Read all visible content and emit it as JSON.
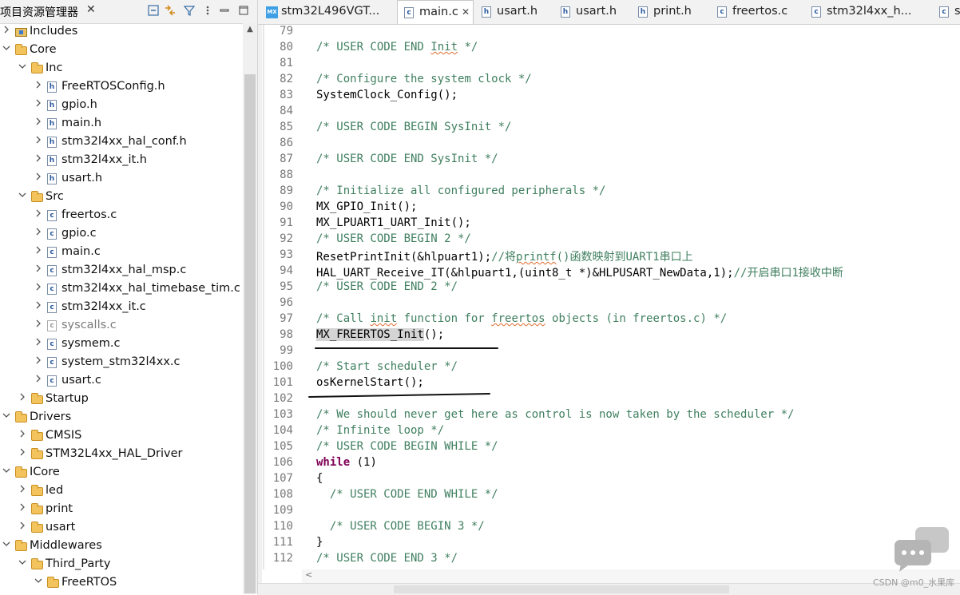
{
  "explorer": {
    "title": "项目资源管理器",
    "close_glyph": "✕",
    "toolbar": [
      "collapse-all-icon",
      "link-editor-icon",
      "filter-icon",
      "view-menu-icon",
      "minimize-icon",
      "maximize-icon"
    ],
    "items": [
      {
        "label": "Includes",
        "icon": "includes",
        "twisty": ">"
      },
      {
        "label": "Core",
        "icon": "folder",
        "twisty": "v"
      },
      {
        "label": "Inc",
        "icon": "folder",
        "twisty": "v"
      },
      {
        "label": "FreeRTOSConfig.h",
        "icon": "h",
        "twisty": ">"
      },
      {
        "label": "gpio.h",
        "icon": "h",
        "twisty": ">"
      },
      {
        "label": "main.h",
        "icon": "h",
        "twisty": ">"
      },
      {
        "label": "stm32l4xx_hal_conf.h",
        "icon": "h",
        "twisty": ">"
      },
      {
        "label": "stm32l4xx_it.h",
        "icon": "h",
        "twisty": ">"
      },
      {
        "label": "usart.h",
        "icon": "h",
        "twisty": ">"
      },
      {
        "label": "Src",
        "icon": "folder",
        "twisty": "v"
      },
      {
        "label": "freertos.c",
        "icon": "c",
        "twisty": ">"
      },
      {
        "label": "gpio.c",
        "icon": "c",
        "twisty": ">"
      },
      {
        "label": "main.c",
        "icon": "c",
        "twisty": ">"
      },
      {
        "label": "stm32l4xx_hal_msp.c",
        "icon": "c",
        "twisty": ">"
      },
      {
        "label": "stm32l4xx_hal_timebase_tim.c",
        "icon": "c",
        "twisty": ">"
      },
      {
        "label": "stm32l4xx_it.c",
        "icon": "c",
        "twisty": ">"
      },
      {
        "label": "syscalls.c",
        "icon": "c-excluded",
        "twisty": ">",
        "dim": true
      },
      {
        "label": "sysmem.c",
        "icon": "c",
        "twisty": ">"
      },
      {
        "label": "system_stm32l4xx.c",
        "icon": "c",
        "twisty": ">"
      },
      {
        "label": "usart.c",
        "icon": "c",
        "twisty": ">"
      },
      {
        "label": "Startup",
        "icon": "folder",
        "twisty": ">"
      },
      {
        "label": "Drivers",
        "icon": "folder",
        "twisty": "v"
      },
      {
        "label": "CMSIS",
        "icon": "folder",
        "twisty": ">"
      },
      {
        "label": "STM32L4xx_HAL_Driver",
        "icon": "folder",
        "twisty": ">"
      },
      {
        "label": "ICore",
        "icon": "folder",
        "twisty": "v"
      },
      {
        "label": "led",
        "icon": "folder",
        "twisty": ">"
      },
      {
        "label": "print",
        "icon": "folder",
        "twisty": ">"
      },
      {
        "label": "usart",
        "icon": "folder",
        "twisty": ">"
      },
      {
        "label": "Middlewares",
        "icon": "folder",
        "twisty": "v"
      },
      {
        "label": "Third_Party",
        "icon": "folder",
        "twisty": "v"
      },
      {
        "label": "FreeRTOS",
        "icon": "folder",
        "twisty": "v"
      }
    ]
  },
  "tabs": [
    {
      "label": "stm32L496VGT...",
      "icon": "mx",
      "active": false
    },
    {
      "label": "main.c",
      "icon": "c",
      "active": true,
      "close": "✕"
    },
    {
      "label": "usart.h",
      "icon": "h",
      "active": false
    },
    {
      "label": "usart.h",
      "icon": "h",
      "active": false
    },
    {
      "label": "print.h",
      "icon": "h",
      "active": false
    },
    {
      "label": "freertos.c",
      "icon": "c",
      "active": false
    },
    {
      "label": "stm32l4xx_h...",
      "icon": "c",
      "active": false
    },
    {
      "label": "st",
      "icon": "c",
      "active": false
    }
  ],
  "code": [
    {
      "n": "79",
      "t": [
        [
          "",
          ""
        ]
      ]
    },
    {
      "n": "80",
      "t": [
        [
          "  ",
          ""
        ],
        [
          "/* USER CODE END ",
          "cm"
        ],
        [
          "Init",
          "cm sq"
        ],
        [
          " */",
          "cm"
        ]
      ]
    },
    {
      "n": "81",
      "t": [
        [
          "",
          ""
        ]
      ]
    },
    {
      "n": "82",
      "t": [
        [
          "  ",
          ""
        ],
        [
          "/* Configure the system clock */",
          "cm"
        ]
      ]
    },
    {
      "n": "83",
      "t": [
        [
          "  SystemClock_Config();",
          ""
        ]
      ]
    },
    {
      "n": "84",
      "t": [
        [
          "",
          ""
        ]
      ]
    },
    {
      "n": "85",
      "t": [
        [
          "  ",
          ""
        ],
        [
          "/* USER CODE BEGIN SysInit */",
          "cm"
        ]
      ]
    },
    {
      "n": "86",
      "t": [
        [
          "",
          ""
        ]
      ]
    },
    {
      "n": "87",
      "t": [
        [
          "  ",
          ""
        ],
        [
          "/* USER CODE END SysInit */",
          "cm"
        ]
      ]
    },
    {
      "n": "88",
      "t": [
        [
          "",
          ""
        ]
      ]
    },
    {
      "n": "89",
      "t": [
        [
          "  ",
          ""
        ],
        [
          "/* Initialize all configured peripherals */",
          "cm"
        ]
      ]
    },
    {
      "n": "90",
      "t": [
        [
          "  MX_GPIO_Init();",
          ""
        ]
      ]
    },
    {
      "n": "91",
      "t": [
        [
          "  MX_LPUART1_UART_Init();",
          ""
        ]
      ]
    },
    {
      "n": "92",
      "t": [
        [
          "  ",
          ""
        ],
        [
          "/* USER CODE BEGIN 2 */",
          "cm"
        ]
      ]
    },
    {
      "n": "93",
      "t": [
        [
          "  ResetPrintInit(&hlpuart1);",
          ""
        ],
        [
          "//将",
          "cm"
        ],
        [
          "printf",
          "cm sq"
        ],
        [
          "()函数映射到UART1串口上",
          "cm"
        ]
      ]
    },
    {
      "n": "94",
      "t": [
        [
          "  HAL_UART_Receive_IT(&hlpuart1,(uint8_t *)&HLPUSART_NewData,1);",
          ""
        ],
        [
          "//开启串口1接收中断",
          "cm"
        ]
      ]
    },
    {
      "n": "95",
      "t": [
        [
          "  ",
          ""
        ],
        [
          "/* USER CODE END 2 */",
          "cm"
        ]
      ]
    },
    {
      "n": "96",
      "t": [
        [
          "",
          ""
        ]
      ]
    },
    {
      "n": "97",
      "t": [
        [
          "  ",
          ""
        ],
        [
          "/* Call ",
          "cm"
        ],
        [
          "init",
          "cm sq"
        ],
        [
          " function for ",
          "cm"
        ],
        [
          "freertos",
          "cm sq"
        ],
        [
          " objects (in freertos.c) */",
          "cm"
        ]
      ]
    },
    {
      "n": "98",
      "t": [
        [
          "  ",
          ""
        ],
        [
          "MX_FREERTOS_Init",
          "hl"
        ],
        [
          "();",
          ""
        ]
      ]
    },
    {
      "n": "99",
      "t": [
        [
          "",
          ""
        ]
      ]
    },
    {
      "n": "100",
      "t": [
        [
          "  ",
          ""
        ],
        [
          "/* Start scheduler */",
          "cm"
        ]
      ]
    },
    {
      "n": "101",
      "t": [
        [
          "  osKernelStart();",
          ""
        ]
      ]
    },
    {
      "n": "102",
      "t": [
        [
          "",
          ""
        ]
      ]
    },
    {
      "n": "103",
      "t": [
        [
          "  ",
          ""
        ],
        [
          "/* We should never get here as control is now taken by the scheduler */",
          "cm"
        ]
      ]
    },
    {
      "n": "104",
      "t": [
        [
          "  ",
          ""
        ],
        [
          "/* Infinite loop */",
          "cm"
        ]
      ]
    },
    {
      "n": "105",
      "t": [
        [
          "  ",
          ""
        ],
        [
          "/* USER CODE BEGIN WHILE */",
          "cm"
        ]
      ]
    },
    {
      "n": "106",
      "t": [
        [
          "  ",
          ""
        ],
        [
          "while",
          "kw"
        ],
        [
          " (1)",
          ""
        ]
      ]
    },
    {
      "n": "107",
      "t": [
        [
          "  {",
          ""
        ]
      ]
    },
    {
      "n": "108",
      "t": [
        [
          "    ",
          ""
        ],
        [
          "/* USER CODE END WHILE */",
          "cm"
        ]
      ]
    },
    {
      "n": "109",
      "t": [
        [
          "",
          ""
        ]
      ]
    },
    {
      "n": "110",
      "t": [
        [
          "    ",
          ""
        ],
        [
          "/* USER CODE BEGIN 3 */",
          "cm"
        ]
      ]
    },
    {
      "n": "111",
      "t": [
        [
          "  }",
          ""
        ]
      ]
    },
    {
      "n": "112",
      "t": [
        [
          "  ",
          ""
        ],
        [
          "/* USER CODE END 3 */",
          "cm"
        ]
      ]
    }
  ],
  "hscroll_left_glyph": "<",
  "watermark": "CSDN @m0_水果库"
}
